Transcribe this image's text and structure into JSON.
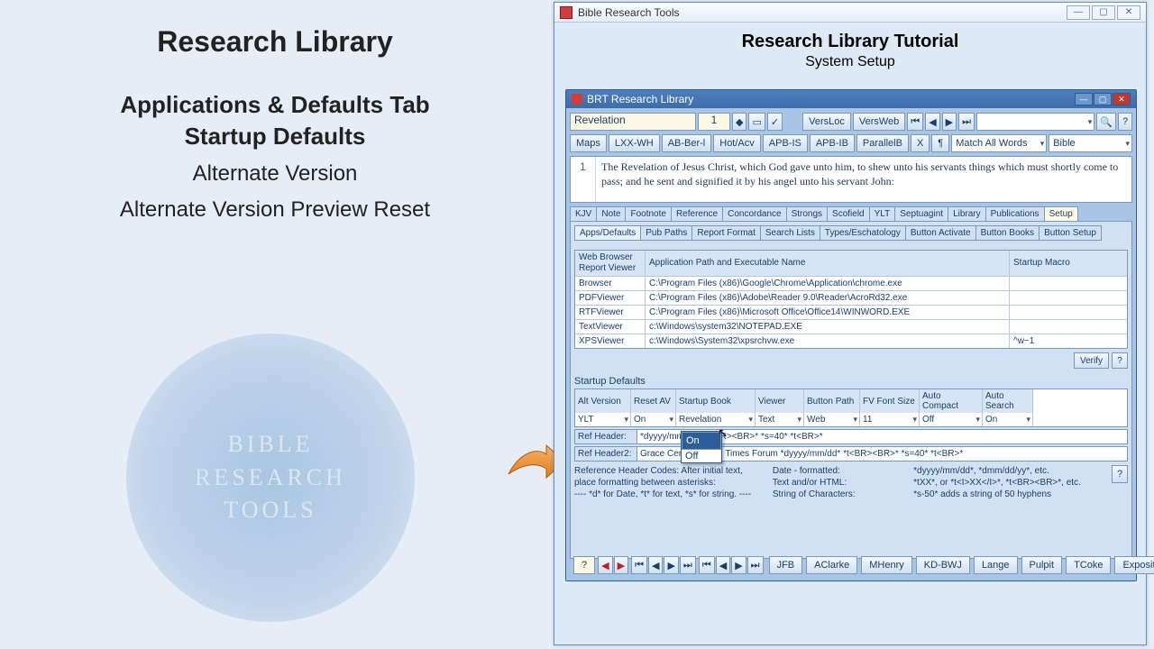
{
  "left": {
    "title": "Research Library",
    "heading1": "Applications & Defaults Tab",
    "heading2": "Startup Defaults",
    "item1": "Alternate Version",
    "item2": "Alternate Version Preview Reset",
    "logo_l1": "BIBLE",
    "logo_l2": "RESEARCH",
    "logo_l3": "TOOLS"
  },
  "outer": {
    "title": "Bible Research Tools",
    "h1": "Research Library Tutorial",
    "h2": "System Setup"
  },
  "inner": {
    "title": "BRT Research Library",
    "search_book": "Revelation",
    "search_num": "1",
    "btn_versloc": "VersLoc",
    "btn_versweb": "VersWeb",
    "row2": [
      "Maps",
      "LXX-WH",
      "AB-Ber-l",
      "Hot/Acv",
      "APB-IS",
      "APB-IB",
      "ParallelB",
      "X",
      "¶"
    ],
    "match_mode": "Match All Words",
    "search_in": "Bible",
    "verse_num": "1",
    "verse_txt": "The Revelation of Jesus Christ, which God gave unto him, to shew unto his servants things which must shortly come to pass; and he sent and signified it by his angel unto his servant John:",
    "maintabs": [
      "KJV",
      "Note",
      "Footnote",
      "Reference",
      "Concordance",
      "Strongs",
      "Scofield",
      "YLT",
      "Septuagint",
      "Library",
      "Publications",
      "Setup"
    ],
    "active_maintab": "Setup",
    "subtabs": [
      "Apps/Defaults",
      "Pub Paths",
      "Report Format",
      "Search Lists",
      "Types/Eschatology",
      "Button Activate",
      "Button Books",
      "Button Setup"
    ],
    "active_subtab": "Apps/Defaults",
    "apptable": {
      "h1": "Web Browser Report Viewer",
      "h2": "Application Path and Executable Name",
      "h3": "Startup Macro",
      "rows": [
        {
          "name": "Browser",
          "path": "C:\\Program Files (x86)\\Google\\Chrome\\Application\\chrome.exe",
          "macro": ""
        },
        {
          "name": "PDFViewer",
          "path": "C:\\Program Files (x86)\\Adobe\\Reader 9.0\\Reader\\AcroRd32.exe",
          "macro": ""
        },
        {
          "name": "RTFViewer",
          "path": "C:\\Program Files (x86)\\Microsoft Office\\Office14\\WINWORD.EXE",
          "macro": ""
        },
        {
          "name": "TextViewer",
          "path": "c:\\Windows\\system32\\NOTEPAD.EXE",
          "macro": ""
        },
        {
          "name": "XPSViewer",
          "path": "c:\\Windows\\System32\\xpsrchvw.exe",
          "macro": "^w~1"
        }
      ]
    },
    "verify": "Verify",
    "sd_title": "Startup Defaults",
    "sd_headers": [
      "Alt Version",
      "Reset AV",
      "Startup Book",
      "Viewer",
      "Button Path",
      "FV Font Size",
      "Auto Compact",
      "Auto Search"
    ],
    "sd_values": [
      "YLT",
      "On",
      "Revelation",
      "Text",
      "Web",
      "11",
      "Off",
      "On"
    ],
    "dd_options": [
      "On",
      "Off"
    ],
    "refh1_lbl": "Ref Header:",
    "refh1_val": "*dyyyy/mm/dd* *t<BR><BR>* *s=40* *t<BR>*",
    "refh2_lbl": "Ref Header2:",
    "refh2_val": "Grace Centered End Times Forum *dyyyy/mm/dd* *t<BR><BR>* *s=40* *t<BR>*",
    "codes": {
      "c1a": "Reference Header Codes: After initial text, place formatting between asterisks:",
      "c1b": "----  *d* for Date, *t* for text, *s* for string. ----",
      "c2a": "Date - formatted:",
      "c2b": "Text and/or HTML:",
      "c2c": "String of Characters:",
      "c3a": "*dyyyy/mm/dd*, *dmm/dd/yy*, etc.",
      "c3b": "*tXX*, or *t<I>XX</I>*, *t<BR><BR>*, etc.",
      "c3c": "*s-50* adds a string of 50 hyphens"
    },
    "bottom": [
      "JFB",
      "AClarke",
      "MHenry",
      "KD-BWJ",
      "Lange",
      "Pulpit",
      "TCoke",
      "Expositor"
    ]
  }
}
